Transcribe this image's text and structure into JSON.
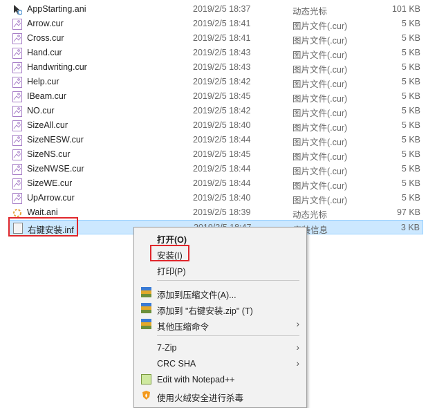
{
  "files": [
    {
      "name": "AppStarting.ani",
      "date": "2019/2/5 18:37",
      "type": "动态光标",
      "size": "101 KB",
      "icon": "animated-cursor-icon"
    },
    {
      "name": "Arrow.cur",
      "date": "2019/2/5 18:41",
      "type": "图片文件(.cur)",
      "size": "5 KB",
      "icon": "image-file-icon"
    },
    {
      "name": "Cross.cur",
      "date": "2019/2/5 18:41",
      "type": "图片文件(.cur)",
      "size": "5 KB",
      "icon": "image-file-icon"
    },
    {
      "name": "Hand.cur",
      "date": "2019/2/5 18:43",
      "type": "图片文件(.cur)",
      "size": "5 KB",
      "icon": "image-file-icon"
    },
    {
      "name": "Handwriting.cur",
      "date": "2019/2/5 18:43",
      "type": "图片文件(.cur)",
      "size": "5 KB",
      "icon": "image-file-icon"
    },
    {
      "name": "Help.cur",
      "date": "2019/2/5 18:42",
      "type": "图片文件(.cur)",
      "size": "5 KB",
      "icon": "image-file-icon"
    },
    {
      "name": "IBeam.cur",
      "date": "2019/2/5 18:45",
      "type": "图片文件(.cur)",
      "size": "5 KB",
      "icon": "image-file-icon"
    },
    {
      "name": "NO.cur",
      "date": "2019/2/5 18:42",
      "type": "图片文件(.cur)",
      "size": "5 KB",
      "icon": "image-file-icon"
    },
    {
      "name": "SizeAll.cur",
      "date": "2019/2/5 18:40",
      "type": "图片文件(.cur)",
      "size": "5 KB",
      "icon": "image-file-icon"
    },
    {
      "name": "SizeNESW.cur",
      "date": "2019/2/5 18:44",
      "type": "图片文件(.cur)",
      "size": "5 KB",
      "icon": "image-file-icon"
    },
    {
      "name": "SizeNS.cur",
      "date": "2019/2/5 18:45",
      "type": "图片文件(.cur)",
      "size": "5 KB",
      "icon": "image-file-icon"
    },
    {
      "name": "SizeNWSE.cur",
      "date": "2019/2/5 18:44",
      "type": "图片文件(.cur)",
      "size": "5 KB",
      "icon": "image-file-icon"
    },
    {
      "name": "SizeWE.cur",
      "date": "2019/2/5 18:44",
      "type": "图片文件(.cur)",
      "size": "5 KB",
      "icon": "image-file-icon"
    },
    {
      "name": "UpArrow.cur",
      "date": "2019/2/5 18:40",
      "type": "图片文件(.cur)",
      "size": "5 KB",
      "icon": "image-file-icon"
    },
    {
      "name": "Wait.ani",
      "date": "2019/2/5 18:39",
      "type": "动态光标",
      "size": "97 KB",
      "icon": "animated-cursor-icon"
    },
    {
      "name": "右键安装.inf",
      "date": "2019/2/5 18:47",
      "type": "安装信息",
      "size": "3 KB",
      "icon": "setup-info-icon",
      "selected": true
    }
  ],
  "menu": [
    {
      "label": "打开(O)",
      "bold": true
    },
    {
      "label": "安装(I)",
      "highlighted": true
    },
    {
      "label": "打印(P)"
    },
    {
      "separator": true
    },
    {
      "label": "添加到压缩文件(A)...",
      "icon": "winrar-icon"
    },
    {
      "label": "添加到 \"右键安装.zip\" (T)",
      "icon": "winrar-icon"
    },
    {
      "label": "其他压缩命令",
      "icon": "winrar-icon",
      "submenu": true
    },
    {
      "separator": true
    },
    {
      "label": "7-Zip",
      "submenu": true
    },
    {
      "label": "CRC SHA",
      "submenu": true
    },
    {
      "label": "Edit with Notepad++",
      "icon": "notepad-plus-plus-icon"
    },
    {
      "label": "使用火绒安全进行杀毒",
      "icon": "huorong-shield-icon"
    }
  ],
  "colors": {
    "selection": "#cce8ff",
    "highlight_box": "#e0262b"
  }
}
